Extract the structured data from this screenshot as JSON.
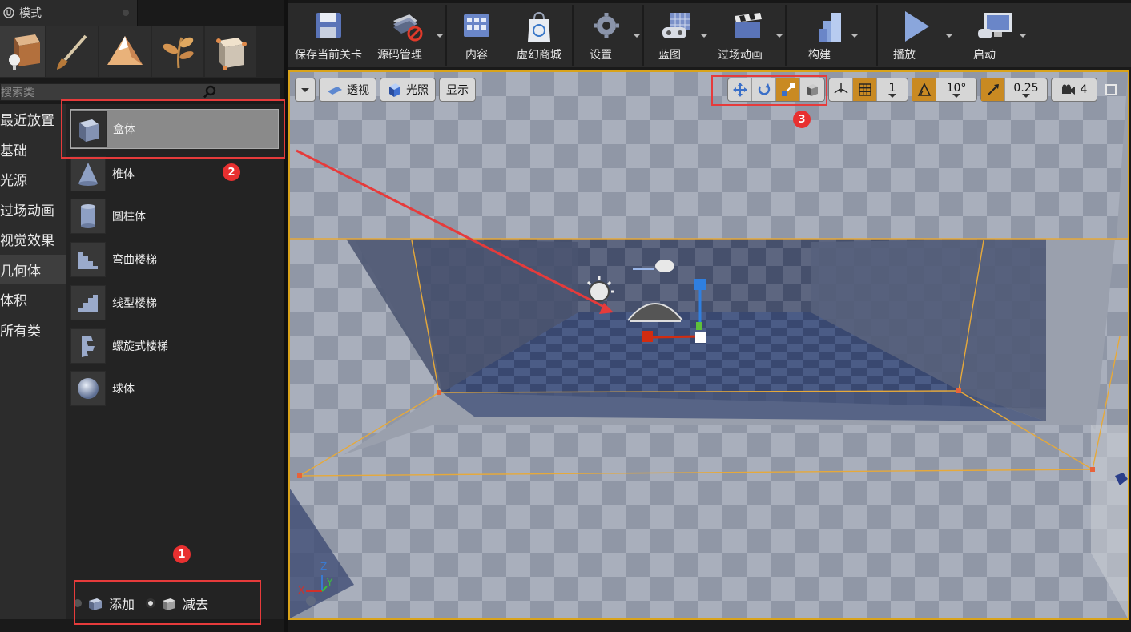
{
  "modes_panel": {
    "tab_title": "模式",
    "search_placeholder": "搜索类",
    "categories": [
      "最近放置",
      "基础",
      "光源",
      "过场动画",
      "视觉效果",
      "几何体",
      "体积",
      "所有类"
    ],
    "active_category": "几何体",
    "geometry_items": [
      {
        "label": "盒体",
        "icon": "box-icon"
      },
      {
        "label": "椎体",
        "icon": "cone-icon"
      },
      {
        "label": "圆柱体",
        "icon": "cylinder-icon"
      },
      {
        "label": "弯曲楼梯",
        "icon": "curved-stair-icon"
      },
      {
        "label": "线型楼梯",
        "icon": "linear-stair-icon"
      },
      {
        "label": "螺旋式楼梯",
        "icon": "spiral-stair-icon"
      },
      {
        "label": "球体",
        "icon": "sphere-icon"
      }
    ],
    "selected_item": "盒体",
    "brush_type": {
      "add_label": "添加",
      "subtract_label": "减去",
      "selected": "减去"
    }
  },
  "main_toolbar": {
    "buttons": [
      {
        "label": "保存当前关卡",
        "icon": "save-icon",
        "dropdown": false
      },
      {
        "label": "源码管理",
        "icon": "source-control-icon",
        "dropdown": true
      },
      {
        "label": "内容",
        "icon": "content-icon",
        "dropdown": false
      },
      {
        "label": "虚幻商城",
        "icon": "marketplace-icon",
        "dropdown": false
      },
      {
        "label": "设置",
        "icon": "settings-icon",
        "dropdown": true
      },
      {
        "label": "蓝图",
        "icon": "blueprint-icon",
        "dropdown": true
      },
      {
        "label": "过场动画",
        "icon": "cinematics-icon",
        "dropdown": true
      },
      {
        "label": "构建",
        "icon": "build-icon",
        "dropdown": true
      },
      {
        "label": "播放",
        "icon": "play-icon",
        "dropdown": true
      },
      {
        "label": "启动",
        "icon": "launch-icon",
        "dropdown": true
      }
    ]
  },
  "viewport_toolbar": {
    "perspective_label": "透视",
    "lighting_label": "光照",
    "show_label": "显示",
    "grid_snap_value": "1",
    "rotation_snap_value": "10°",
    "scale_snap_value": "0.25",
    "camera_speed_value": "4"
  },
  "viewport": {
    "axis_labels": {
      "x": "X",
      "y": "Y",
      "z": "Z"
    }
  },
  "annotations": {
    "badge_1": "1",
    "badge_2": "2",
    "badge_3": "3"
  },
  "colors": {
    "highlight_red": "#e63b3b",
    "viewport_border": "#d9a31a",
    "snap_orange": "#c98a22"
  }
}
